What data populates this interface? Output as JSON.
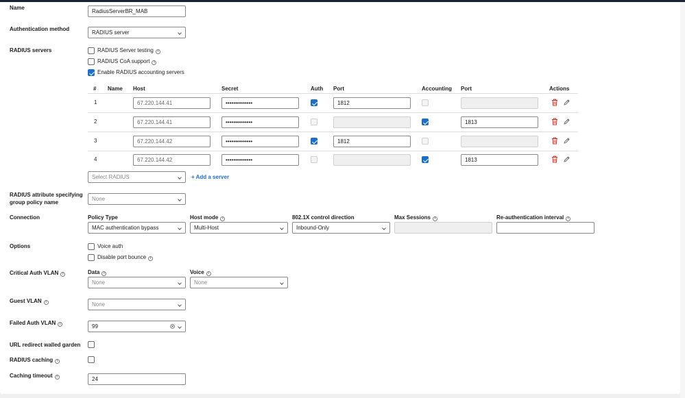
{
  "form": {
    "name_label": "Name",
    "name_value": "RadiusServerBR_MAB",
    "auth_method_label": "Authentication method",
    "auth_method_value": "RADIUS server",
    "radius_servers_label": "RADIUS servers",
    "options": {
      "server_testing": {
        "label": "RADIUS Server testing",
        "checked": false
      },
      "coa_support": {
        "label": "RADIUS CoA support",
        "checked": false
      },
      "accounting_servers": {
        "label": "Enable RADIUS accounting servers",
        "checked": true
      }
    },
    "table": {
      "headers": {
        "num": "#",
        "name": "Name",
        "host": "Host",
        "secret": "Secret",
        "auth": "Auth",
        "port": "Port",
        "accounting": "Accounting",
        "acct_port": "Port",
        "actions": "Actions"
      },
      "rows": [
        {
          "num": "1",
          "host": "67.220.144.41",
          "secret": "••••••••••••••",
          "auth": true,
          "port": "1812",
          "accounting": false,
          "acct_port": ""
        },
        {
          "num": "2",
          "host": "67.220.144.41",
          "secret": "••••••••••••••",
          "auth": false,
          "port": "",
          "accounting": true,
          "acct_port": "1813"
        },
        {
          "num": "3",
          "host": "67.220.144.42",
          "secret": "••••••••••••••",
          "auth": true,
          "port": "1812",
          "accounting": false,
          "acct_port": ""
        },
        {
          "num": "4",
          "host": "67.220.144.42",
          "secret": "••••••••••••••",
          "auth": false,
          "port": "",
          "accounting": true,
          "acct_port": "1813"
        }
      ],
      "select_placeholder": "Select RADIUS",
      "add_server": "+ Add a server"
    },
    "attr_label_1": "RADIUS attribute specifying",
    "attr_label_2": "group policy name",
    "attr_value": "None",
    "connection_label": "Connection",
    "connection": {
      "policy_type_label": "Policy Type",
      "policy_type_value": "MAC authentication bypass",
      "host_mode_label": "Host mode",
      "host_mode_value": "Multi-Host",
      "control_dir_label": "802.1X control direction",
      "control_dir_value": "Inbound-Only",
      "max_sessions_label": "Max Sessions",
      "max_sessions_value": "",
      "reauth_label": "Re-authentication interval",
      "reauth_value": ""
    },
    "options_label": "Options",
    "voice_auth": {
      "label": "Voice auth",
      "checked": false
    },
    "disable_bounce": {
      "label": "Disable port bounce",
      "checked": false
    },
    "critical_vlan_label": "Critical Auth VLAN",
    "critical_data_label": "Data",
    "critical_data_value": "None",
    "critical_voice_label": "Voice",
    "critical_voice_value": "None",
    "guest_vlan_label": "Guest VLAN",
    "guest_vlan_value": "None",
    "failed_vlan_label": "Failed Auth VLAN",
    "failed_vlan_value": "99",
    "url_redirect_label": "URL redirect walled garden",
    "radius_caching_label": "RADIUS caching",
    "caching_timeout_label": "Caching timeout",
    "caching_timeout_value": "24"
  },
  "colors": {
    "accent": "#1b6fd1",
    "danger": "#d93025",
    "topbar": "#1b2333"
  },
  "icons": [
    "info-icon",
    "chevron-down-icon",
    "trash-icon",
    "pencil-icon",
    "clear-icon",
    "checkmark-icon"
  ]
}
